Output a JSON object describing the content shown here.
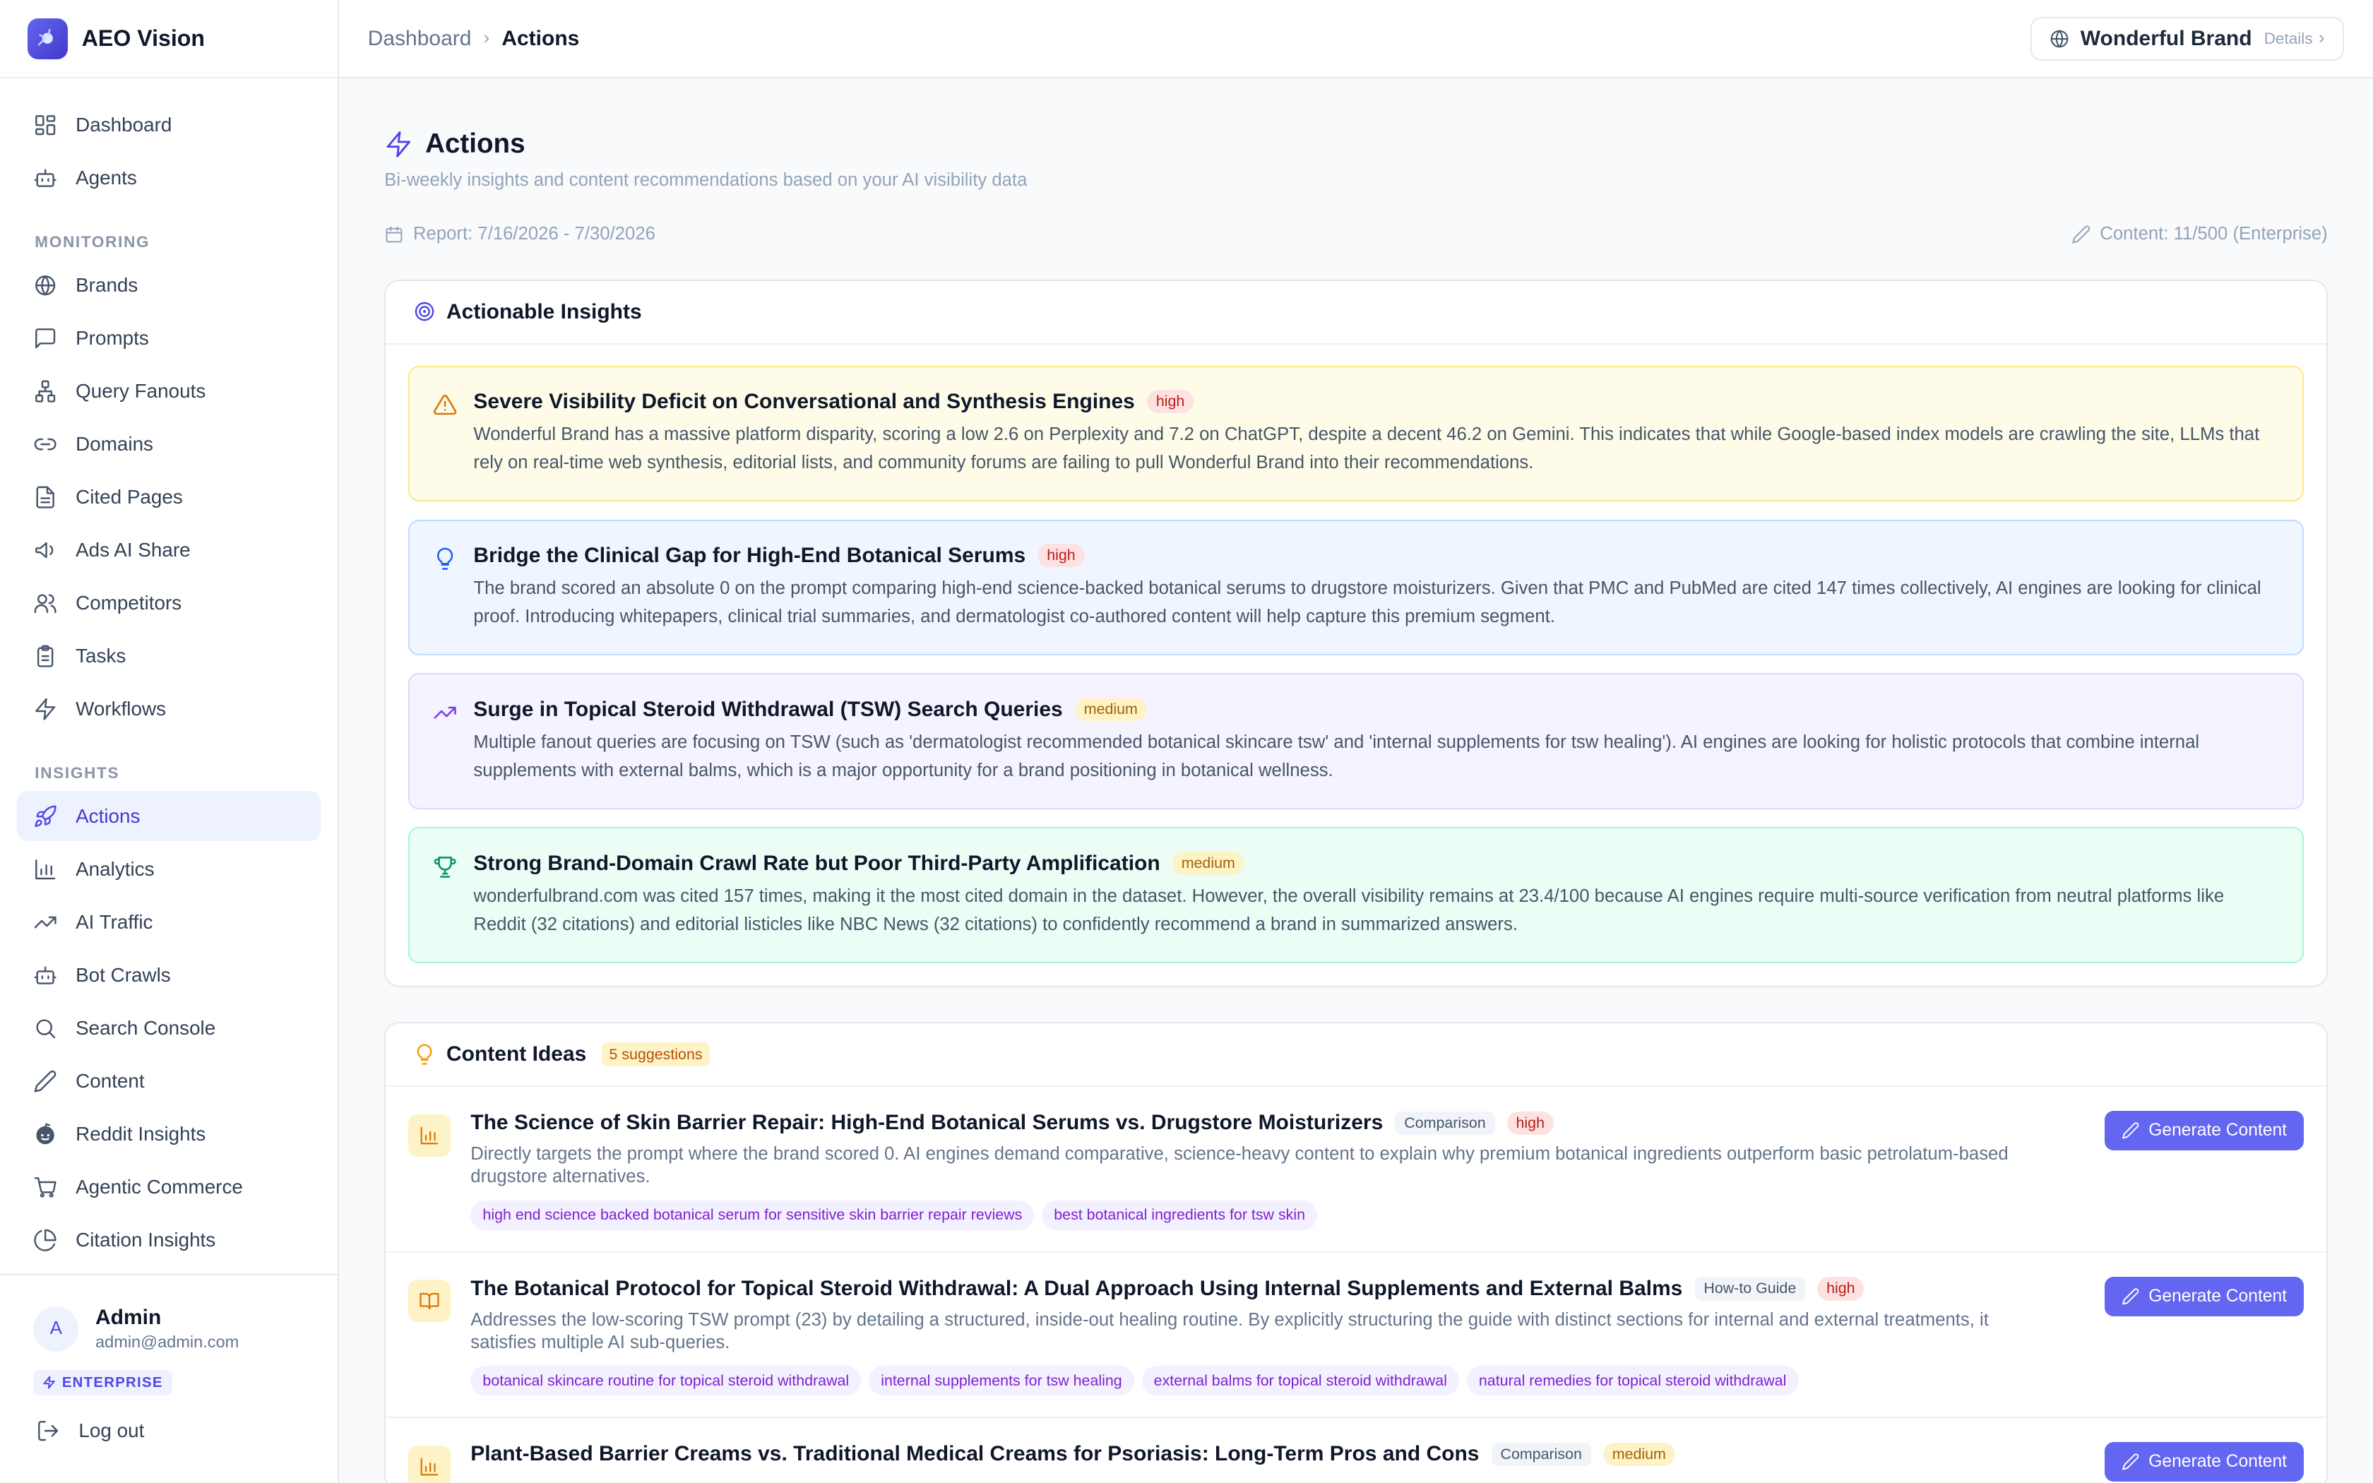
{
  "app": {
    "name": "AEO Vision"
  },
  "nav": {
    "top": [
      {
        "label": "Dashboard",
        "icon": "dashboard-icon"
      },
      {
        "label": "Agents",
        "icon": "bot-icon"
      }
    ],
    "monitoring_label": "MONITORING",
    "monitoring": [
      {
        "label": "Brands",
        "icon": "globe-icon"
      },
      {
        "label": "Prompts",
        "icon": "message-icon"
      },
      {
        "label": "Query Fanouts",
        "icon": "network-icon"
      },
      {
        "label": "Domains",
        "icon": "link-icon"
      },
      {
        "label": "Cited Pages",
        "icon": "file-icon"
      },
      {
        "label": "Ads AI Share",
        "icon": "megaphone-icon"
      },
      {
        "label": "Competitors",
        "icon": "users-icon"
      },
      {
        "label": "Tasks",
        "icon": "clipboard-icon"
      },
      {
        "label": "Workflows",
        "icon": "zap-icon"
      }
    ],
    "insights_label": "INSIGHTS",
    "insights": [
      {
        "label": "Actions",
        "icon": "rocket-icon",
        "active": true
      },
      {
        "label": "Analytics",
        "icon": "bar-chart-icon"
      },
      {
        "label": "AI Traffic",
        "icon": "trending-up-icon"
      },
      {
        "label": "Bot Crawls",
        "icon": "bot-icon"
      },
      {
        "label": "Search Console",
        "icon": "search-icon"
      },
      {
        "label": "Content",
        "icon": "pencil-icon"
      },
      {
        "label": "Reddit Insights",
        "icon": "reddit-icon"
      },
      {
        "label": "Agentic Commerce",
        "icon": "cart-icon"
      },
      {
        "label": "Citation Insights",
        "icon": "pie-icon"
      }
    ]
  },
  "user": {
    "initial": "A",
    "name": "Admin",
    "email": "admin@admin.com",
    "plan": "ENTERPRISE",
    "logout": "Log out"
  },
  "topbar": {
    "crumb_root": "Dashboard",
    "crumb_current": "Actions",
    "brand": "Wonderful Brand",
    "details": "Details"
  },
  "page": {
    "title": "Actions",
    "subtitle": "Bi-weekly insights and content recommendations based on your AI visibility data",
    "report": "Report: 7/16/2026 - 7/30/2026",
    "content_quota": "Content: 11/500 (Enterprise)"
  },
  "insights_card": {
    "title": "Actionable Insights",
    "items": [
      {
        "title": "Severe Visibility Deficit on Conversational and Synthesis Engines",
        "priority": "high",
        "body": "Wonderful Brand has a massive platform disparity, scoring a low 2.6 on Perplexity and 7.2 on ChatGPT, despite a decent 46.2 on Gemini. This indicates that while Google-based index models are crawling the site, LLMs that rely on real-time web synthesis, editorial lists, and community forums are failing to pull Wonderful Brand into their recommendations."
      },
      {
        "title": "Bridge the Clinical Gap for High-End Botanical Serums",
        "priority": "high",
        "body": "The brand scored an absolute 0 on the prompt comparing high-end science-backed botanical serums to drugstore moisturizers. Given that PMC and PubMed are cited 147 times collectively, AI engines are looking for clinical proof. Introducing whitepapers, clinical trial summaries, and dermatologist co-authored content will help capture this premium segment."
      },
      {
        "title": "Surge in Topical Steroid Withdrawal (TSW) Search Queries",
        "priority": "medium",
        "body": "Multiple fanout queries are focusing on TSW (such as 'dermatologist recommended botanical skincare tsw' and 'internal supplements for tsw healing'). AI engines are looking for holistic protocols that combine internal supplements with external balms, which is a major opportunity for a brand positioning in botanical wellness."
      },
      {
        "title": "Strong Brand-Domain Crawl Rate but Poor Third-Party Amplification",
        "priority": "medium",
        "body": "wonderfulbrand.com was cited 157 times, making it the most cited domain in the dataset. However, the overall visibility remains at 23.4/100 because AI engines require multi-source verification from neutral platforms like Reddit (32 citations) and editorial listicles like NBC News (32 citations) to confidently recommend a brand in summarized answers."
      }
    ]
  },
  "ideas_card": {
    "title": "Content Ideas",
    "count": "5 suggestions",
    "button": "Generate Content",
    "items": [
      {
        "title": "The Science of Skin Barrier Repair: High-End Botanical Serums vs. Drugstore Moisturizers",
        "type": "Comparison",
        "priority": "high",
        "desc": "Directly targets the prompt where the brand scored 0. AI engines demand comparative, science-heavy content to explain why premium botanical ingredients outperform basic petrolatum-based drugstore alternatives.",
        "tags": [
          "high end science backed botanical serum for sensitive skin barrier repair reviews",
          "best botanical ingredients for tsw skin"
        ]
      },
      {
        "title": "The Botanical Protocol for Topical Steroid Withdrawal: A Dual Approach Using Internal Supplements and External Balms",
        "type": "How-to Guide",
        "priority": "high",
        "desc": "Addresses the low-scoring TSW prompt (23) by detailing a structured, inside-out healing routine. By explicitly structuring the guide with distinct sections for internal and external treatments, it satisfies multiple AI sub-queries.",
        "tags": [
          "botanical skincare routine for topical steroid withdrawal",
          "internal supplements for tsw healing",
          "external balms for topical steroid withdrawal",
          "natural remedies for topical steroid withdrawal"
        ]
      },
      {
        "title": "Plant-Based Barrier Creams vs. Traditional Medical Creams for Psoriasis: Long-Term Pros and Cons",
        "type": "Comparison",
        "priority": "medium",
        "desc": "",
        "tags": []
      }
    ]
  }
}
